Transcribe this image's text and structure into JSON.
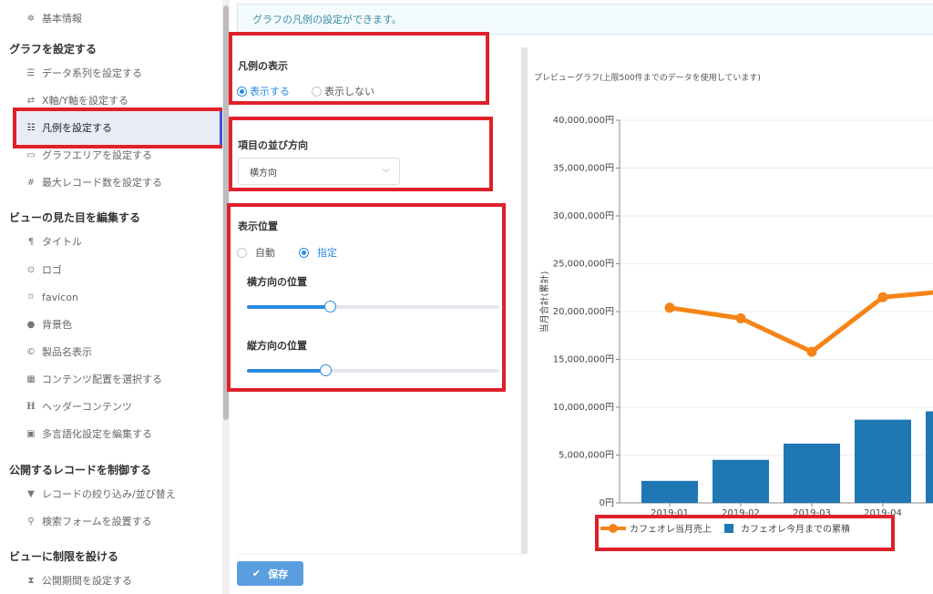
{
  "sidebar": {
    "top_item": "基本情報",
    "sections": [
      {
        "heading": "グラフを設定する",
        "items": [
          {
            "label": "データ系列を設定する",
            "icon": "database-icon"
          },
          {
            "label": "X軸/Y軸を設定する",
            "icon": "swap-arrows-icon"
          },
          {
            "label": "凡例を設定する",
            "icon": "list-icon",
            "active": true
          },
          {
            "label": "グラフエリアを設定する",
            "icon": "chart-area-icon"
          },
          {
            "label": "最大レコード数を設定する",
            "icon": "hash-icon"
          }
        ]
      },
      {
        "heading": "ビューの見た目を編集する",
        "items": [
          {
            "label": "タイトル",
            "icon": "paragraph-icon"
          },
          {
            "label": "ロゴ",
            "icon": "eye-icon"
          },
          {
            "label": "favicon",
            "icon": "bookmark-icon"
          },
          {
            "label": "背景色",
            "icon": "drop-icon"
          },
          {
            "label": "製品名表示",
            "icon": "copyright-icon"
          },
          {
            "label": "コンテンツ配置を選択する",
            "icon": "grid-icon"
          },
          {
            "label": "ヘッダーコンテンツ",
            "icon": "header-icon"
          },
          {
            "label": "多言語化設定を編集する",
            "icon": "language-icon"
          }
        ]
      },
      {
        "heading": "公開するレコードを制御する",
        "items": [
          {
            "label": "レコードの絞り込み/並び替え",
            "icon": "filter-icon"
          },
          {
            "label": "検索フォームを設置する",
            "icon": "search-icon"
          }
        ]
      },
      {
        "heading": "ビューに制限を設ける",
        "items": [
          {
            "label": "公開期間を設定する",
            "icon": "hourglass-icon"
          }
        ]
      }
    ]
  },
  "banner": "グラフの凡例の設定ができます。",
  "legend_display": {
    "title": "凡例の表示",
    "options": [
      "表示する",
      "表示しない"
    ],
    "selected": 0
  },
  "item_direction": {
    "title": "項目の並び方向",
    "value": "横方向"
  },
  "position": {
    "title": "表示位置",
    "options": [
      "自動",
      "指定"
    ],
    "selected": 1,
    "horizontal_label": "横方向の位置",
    "horizontal_value": 0.33,
    "vertical_label": "縦方向の位置",
    "vertical_value": 0.31
  },
  "save_label": "保存",
  "preview_caption": "プレビューグラフ(上限500件までのデータを使用しています)",
  "colors": {
    "accent": "#2a8ae0",
    "highlight": "#e0202a",
    "line_series": "#f58518",
    "bar_series": "#1f77b4"
  },
  "chart_data": {
    "type": "bar",
    "categories": [
      "2019-01",
      "2019-02",
      "2019-03",
      "2019-04"
    ],
    "series": [
      {
        "name": "カフェオレ当月売上",
        "type": "line",
        "values": [
          20400000,
          19300000,
          15800000,
          21500000
        ]
      },
      {
        "name": "カフェオレ今月までの累積",
        "type": "bar",
        "values": [
          2300000,
          4500000,
          6200000,
          8700000
        ]
      }
    ],
    "extra_line_point": 22100000,
    "ylabel": "当月合計(累計)",
    "ylim": [
      0,
      40000000
    ],
    "yticks": [
      "0円",
      "5,000,000円",
      "10,000,000円",
      "15,000,000円",
      "20,000,000円",
      "25,000,000円",
      "30,000,000円",
      "35,000,000円",
      "40,000,000円"
    ],
    "grid": true,
    "legend_position": "bottom"
  }
}
